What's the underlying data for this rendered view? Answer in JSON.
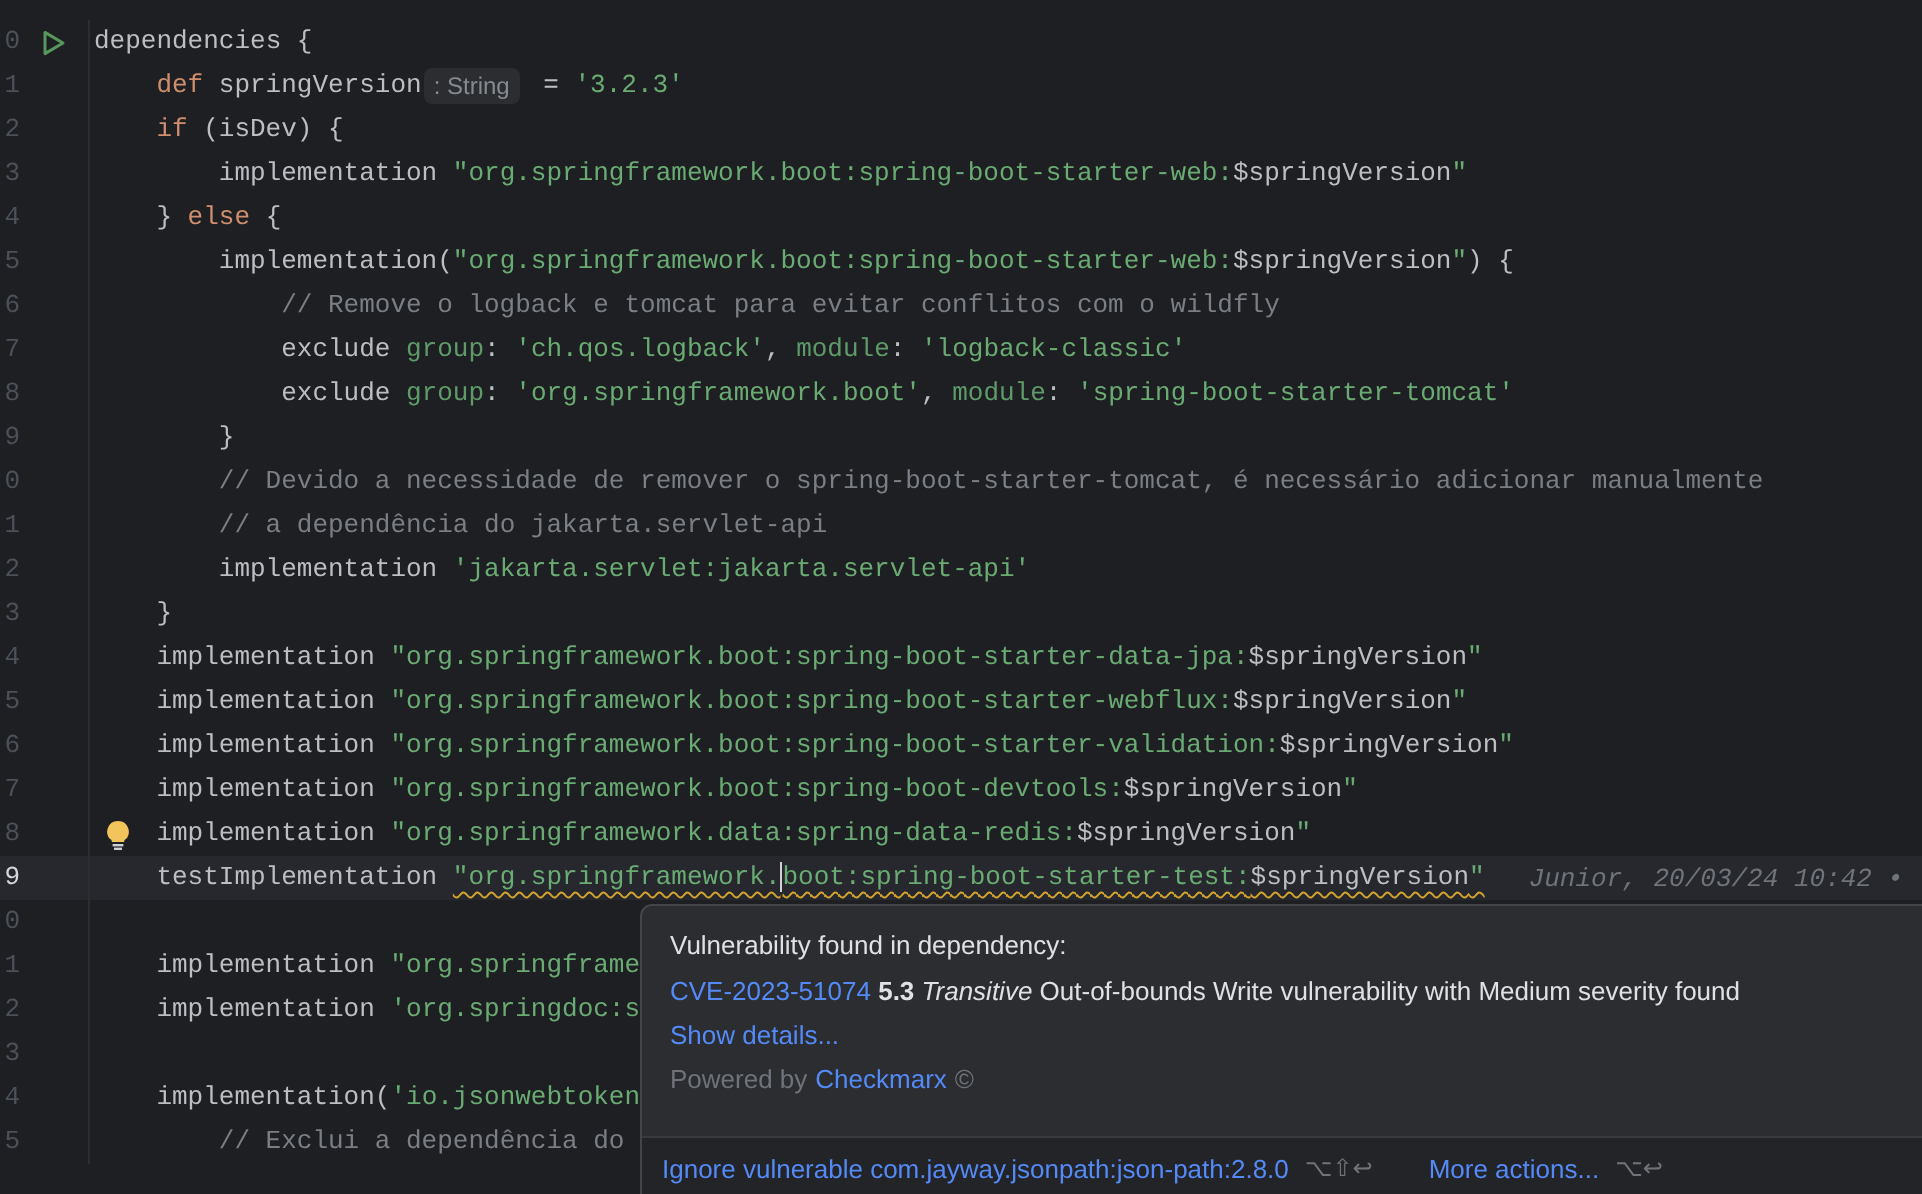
{
  "editor": {
    "lines": [
      {
        "number": "0",
        "runnable": true,
        "current": false,
        "tokens": [
          {
            "kind": "plain",
            "text": "dependencies {"
          }
        ],
        "children": [
          {
            "number": "1",
            "current": false,
            "tokens": [
              {
                "kind": "keyword",
                "text": "def "
              },
              {
                "kind": "plain",
                "text": "springVersion"
              },
              {
                "kind": "hint",
                "text": ": String"
              },
              {
                "kind": "plain",
                "text": " = "
              },
              {
                "kind": "string",
                "text": "'3.2.3'"
              }
            ]
          },
          {
            "number": "2",
            "current": false,
            "tokens": [
              {
                "kind": "keyword",
                "text": "if "
              },
              {
                "kind": "plain",
                "text": "(isDev) {"
              }
            ],
            "children": [
              {
                "number": "3",
                "current": false,
                "tokens": [
                  {
                    "kind": "plain",
                    "text": "implementation "
                  },
                  {
                    "kind": "string",
                    "text": "\"org.springframework.boot:spring-boot-starter-web:"
                  },
                  {
                    "kind": "plain",
                    "text": "$springVersion"
                  },
                  {
                    "kind": "string",
                    "text": "\""
                  }
                ]
              }
            ]
          },
          {
            "number": "4",
            "current": false,
            "tokens": [
              {
                "kind": "plain",
                "text": "} "
              },
              {
                "kind": "keyword",
                "text": "else "
              },
              {
                "kind": "plain",
                "text": "{"
              }
            ],
            "children": [
              {
                "number": "5",
                "current": false,
                "tokens": [
                  {
                    "kind": "plain",
                    "text": "implementation("
                  },
                  {
                    "kind": "string",
                    "text": "\"org.springframework.boot:spring-boot-starter-web:"
                  },
                  {
                    "kind": "plain",
                    "text": "$springVersion"
                  },
                  {
                    "kind": "string",
                    "text": "\""
                  },
                  {
                    "kind": "plain",
                    "text": ") {"
                  }
                ],
                "children": [
                  {
                    "number": "6",
                    "current": false,
                    "tokens": [
                      {
                        "kind": "comment",
                        "text": "// Remove o logback e tomcat para evitar conflitos com o wildfly"
                      }
                    ]
                  },
                  {
                    "number": "7",
                    "current": false,
                    "tokens": [
                      {
                        "kind": "plain",
                        "text": "exclude "
                      },
                      {
                        "kind": "label",
                        "text": "group"
                      },
                      {
                        "kind": "plain",
                        "text": ": "
                      },
                      {
                        "kind": "string",
                        "text": "'ch.qos.logback'"
                      },
                      {
                        "kind": "plain",
                        "text": ", "
                      },
                      {
                        "kind": "label",
                        "text": "module"
                      },
                      {
                        "kind": "plain",
                        "text": ": "
                      },
                      {
                        "kind": "string",
                        "text": "'logback-classic'"
                      }
                    ]
                  },
                  {
                    "number": "8",
                    "current": false,
                    "tokens": [
                      {
                        "kind": "plain",
                        "text": "exclude "
                      },
                      {
                        "kind": "label",
                        "text": "group"
                      },
                      {
                        "kind": "plain",
                        "text": ": "
                      },
                      {
                        "kind": "string",
                        "text": "'org.springframework.boot'"
                      },
                      {
                        "kind": "plain",
                        "text": ", "
                      },
                      {
                        "kind": "label",
                        "text": "module"
                      },
                      {
                        "kind": "plain",
                        "text": ": "
                      },
                      {
                        "kind": "string",
                        "text": "'spring-boot-starter-tomcat'"
                      }
                    ]
                  }
                ]
              },
              {
                "number": "9",
                "current": false,
                "tokens": [
                  {
                    "kind": "plain",
                    "text": "}"
                  }
                ]
              },
              {
                "number": "0",
                "current": false,
                "tokens": [
                  {
                    "kind": "comment",
                    "text": "// Devido a necessidade de remover o spring-boot-starter-tomcat, é necessário adicionar manualmente"
                  }
                ]
              },
              {
                "number": "1",
                "current": false,
                "tokens": [
                  {
                    "kind": "comment",
                    "text": "// a dependência do jakarta.servlet-api"
                  }
                ]
              },
              {
                "number": "2",
                "current": false,
                "tokens": [
                  {
                    "kind": "plain",
                    "text": "implementation "
                  },
                  {
                    "kind": "string",
                    "text": "'jakarta.servlet:jakarta.servlet-api'"
                  }
                ]
              }
            ]
          },
          {
            "number": "3",
            "current": false,
            "tokens": [
              {
                "kind": "plain",
                "text": "}"
              }
            ]
          },
          {
            "number": "4",
            "current": false,
            "tokens": [
              {
                "kind": "plain",
                "text": "implementation "
              },
              {
                "kind": "string",
                "text": "\"org.springframework.boot:spring-boot-starter-data-jpa:"
              },
              {
                "kind": "plain",
                "text": "$springVersion"
              },
              {
                "kind": "string",
                "text": "\""
              }
            ]
          },
          {
            "number": "5",
            "current": false,
            "tokens": [
              {
                "kind": "plain",
                "text": "implementation "
              },
              {
                "kind": "string",
                "text": "\"org.springframework.boot:spring-boot-starter-webflux:"
              },
              {
                "kind": "plain",
                "text": "$springVersion"
              },
              {
                "kind": "string",
                "text": "\""
              }
            ]
          },
          {
            "number": "6",
            "current": false,
            "tokens": [
              {
                "kind": "plain",
                "text": "implementation "
              },
              {
                "kind": "string",
                "text": "\"org.springframework.boot:spring-boot-starter-validation:"
              },
              {
                "kind": "plain",
                "text": "$springVersion"
              },
              {
                "kind": "string",
                "text": "\""
              }
            ]
          },
          {
            "number": "7",
            "current": false,
            "tokens": [
              {
                "kind": "plain",
                "text": "implementation "
              },
              {
                "kind": "string",
                "text": "\"org.springframework.boot:spring-boot-devtools:"
              },
              {
                "kind": "plain",
                "text": "$springVersion"
              },
              {
                "kind": "string",
                "text": "\""
              }
            ]
          },
          {
            "number": "8",
            "has_hint": true,
            "current": false,
            "tokens": [
              {
                "kind": "plain",
                "text": "implementation "
              },
              {
                "kind": "string",
                "text": "\"org.springframework.data:spring-data-redis:"
              },
              {
                "kind": "plain",
                "text": "$springVersion"
              },
              {
                "kind": "string",
                "text": "\""
              }
            ]
          },
          {
            "number": "9",
            "current": true,
            "blame": "Junior, 20/03/24 10:42 •",
            "tokens": [
              {
                "kind": "plain",
                "text": "testImplementation "
              },
              {
                "kind": "string",
                "text": "\"org.springframework.",
                "warning": true
              },
              {
                "kind": "string",
                "text": "boot:spring-boot-starter-test:",
                "warning": true,
                "caret": true
              },
              {
                "kind": "plain",
                "text": "$springVersion",
                "warning": true
              },
              {
                "kind": "string",
                "text": "\"",
                "warning": true
              }
            ]
          },
          {
            "number": "0",
            "current": false
          },
          {
            "number": "1",
            "current": false,
            "tokens": [
              {
                "kind": "plain",
                "text": "implementation "
              },
              {
                "kind": "string",
                "text": "\"org.springframe"
              }
            ]
          },
          {
            "number": "2",
            "current": false,
            "tokens": [
              {
                "kind": "plain",
                "text": "implementation "
              },
              {
                "kind": "string",
                "text": "'org.springdoc:s"
              }
            ]
          },
          {
            "number": "3",
            "current": false
          },
          {
            "number": "4",
            "current": false,
            "tokens": [
              {
                "kind": "plain",
                "text": "implementation("
              },
              {
                "kind": "string",
                "text": "'io.jsonwebtoken"
              }
            ],
            "children": [
              {
                "number": "5",
                "current": false,
                "tokens": [
                  {
                    "kind": "comment",
                    "text": "// Exclui a dependência do"
                  }
                ]
              }
            ]
          }
        ]
      }
    ]
  },
  "popup": {
    "title": "Vulnerability found in dependency:",
    "cve_link": "CVE-2023-51074",
    "summary": "**5.3** *Transitive* Out-of-bounds Write vulnerability with Medium severity found",
    "details_link": "Show details...",
    "powered_by": "Powered by",
    "powered_link": "Checkmarx",
    "powered_mark": "©",
    "actions": [
      {
        "label": "Ignore vulnerable com.jayway.jsonpath:json-path:2.8.0",
        "shortcut": "⌥⇧↩"
      },
      {
        "label": "More actions...",
        "shortcut": "⌥↩"
      }
    ]
  }
}
